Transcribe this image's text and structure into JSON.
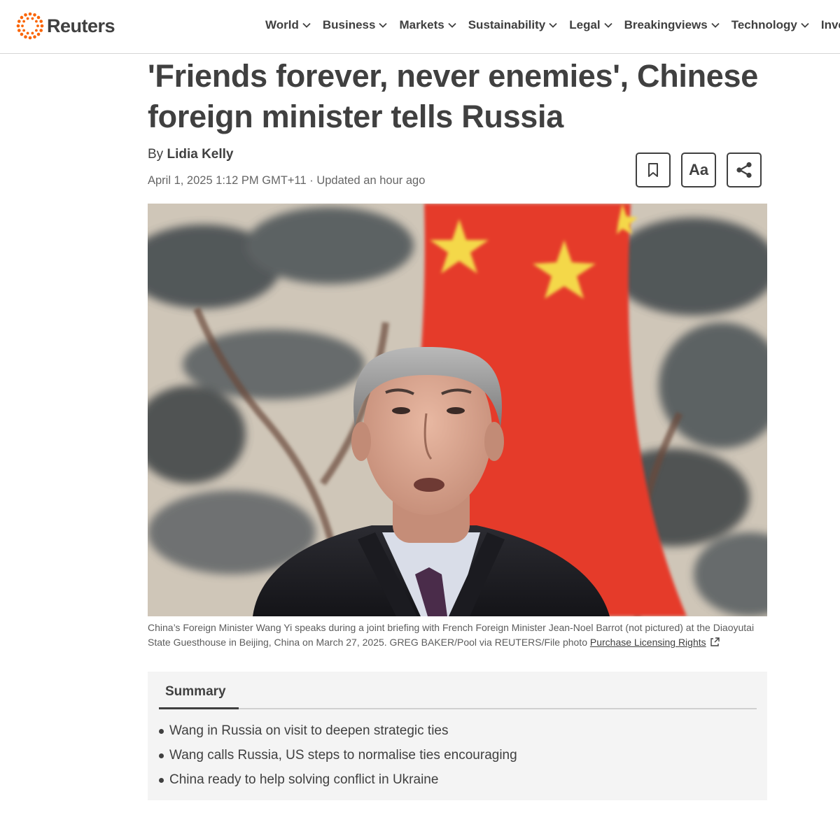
{
  "brand": {
    "name": "Reuters",
    "logo_icon": "reuters-dots-icon",
    "accent": "#fa6400"
  },
  "nav": {
    "items": [
      {
        "label": "World"
      },
      {
        "label": "Business"
      },
      {
        "label": "Markets"
      },
      {
        "label": "Sustainability"
      },
      {
        "label": "Legal"
      },
      {
        "label": "Breakingviews"
      },
      {
        "label": "Technology"
      },
      {
        "label": "Investi"
      }
    ],
    "chevron_icon": "chevron-down-icon"
  },
  "article": {
    "headline": "'Friends forever, never enemies', Chinese foreign minister tells Russia",
    "byline_prefix": "By",
    "author": "Lidia Kelly",
    "dateline": "April 1, 2025 1:12 PM GMT+11 · Updated an hour ago",
    "tools": {
      "bookmark_icon": "bookmark-icon",
      "text_size_label": "Aa",
      "share_icon": "share-icon"
    },
    "photo": {
      "caption": "China’s Foreign Minister Wang Yi speaks during a joint briefing with French Foreign Minister Jean-Noel Barrot (not pictured) at the Diaoyutai State Guesthouse in Beijing, China on March 27, 2025. GREG BAKER/Pool via REUTERS/File photo",
      "licensing_link": "Purchase Licensing Rights",
      "licensing_icon": "external-link-icon"
    },
    "summary": {
      "tab_label": "Summary",
      "points": [
        "Wang in Russia on visit to deepen strategic ties",
        "Wang calls Russia, US steps to normalise ties encouraging",
        "China ready to help solving conflict in Ukraine"
      ]
    }
  },
  "colors": {
    "text": "#404040",
    "flag_red": "#e53a2a",
    "flag_yellow": "#f4d84a"
  }
}
